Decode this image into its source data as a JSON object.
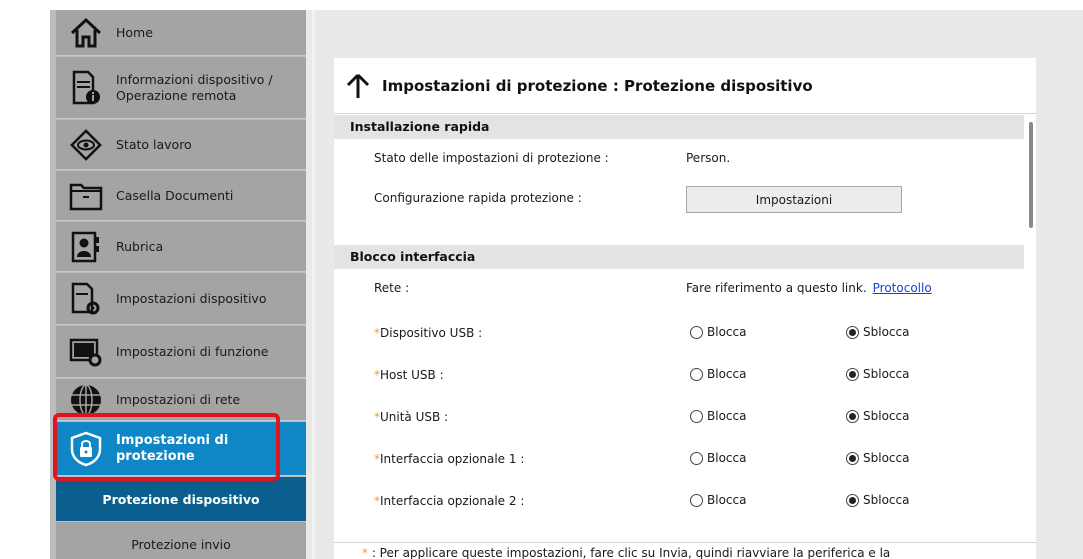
{
  "sidebar": {
    "items": [
      {
        "label": "Home",
        "icon": "home-icon"
      },
      {
        "label": "Informazioni dispositivo / Operazione remota",
        "icon": "device-info-icon"
      },
      {
        "label": "Stato lavoro",
        "icon": "eye-icon"
      },
      {
        "label": "Casella Documenti",
        "icon": "folder-icon"
      },
      {
        "label": "Rubrica",
        "icon": "address-book-icon"
      },
      {
        "label": "Impostazioni dispositivo",
        "icon": "device-settings-icon"
      },
      {
        "label": "Impostazioni di funzione",
        "icon": "function-settings-icon"
      },
      {
        "label": "Impostazioni di rete",
        "icon": "globe-icon"
      },
      {
        "label": "Impostazioni di protezione",
        "icon": "shield-lock-icon"
      }
    ],
    "subitems": [
      {
        "label": "Protezione dispositivo",
        "active": true
      },
      {
        "label": "Protezione invio",
        "active": false
      }
    ]
  },
  "panel": {
    "title": "Impostazioni di protezione : Protezione dispositivo",
    "quick_setup": {
      "header": "Installazione rapida",
      "status_label": "Stato delle impostazioni di protezione :",
      "status_value": "Person.",
      "config_label": "Configurazione rapida protezione :",
      "config_button": "Impostazioni"
    },
    "interface_block": {
      "header": "Blocco interfaccia",
      "network_label": "Rete :",
      "network_text": "Fare riferimento a questo link.",
      "network_link": "Protocollo",
      "required_mark": "*",
      "lock_label": "Blocca",
      "unlock_label": "Sblocca",
      "rows": [
        {
          "label": "Dispositivo USB :",
          "selected": "Sblocca"
        },
        {
          "label": "Host USB :",
          "selected": "Sblocca"
        },
        {
          "label": "Unità USB :",
          "selected": "Sblocca"
        },
        {
          "label": "Interfaccia opzionale 1 :",
          "selected": "Sblocca"
        },
        {
          "label": "Interfaccia opzionale 2 :",
          "selected": "Sblocca"
        }
      ]
    },
    "footnote_mark": "*",
    "footnote": ":  Per applicare queste impostazioni, fare clic su Invia, quindi riavviare la periferica e la"
  },
  "colors": {
    "active_nav": "#0f87c6",
    "active_subnav": "#0b5f8e",
    "highlight": "#e0141e",
    "required": "#e8a23a",
    "link": "#1a3fd6"
  }
}
